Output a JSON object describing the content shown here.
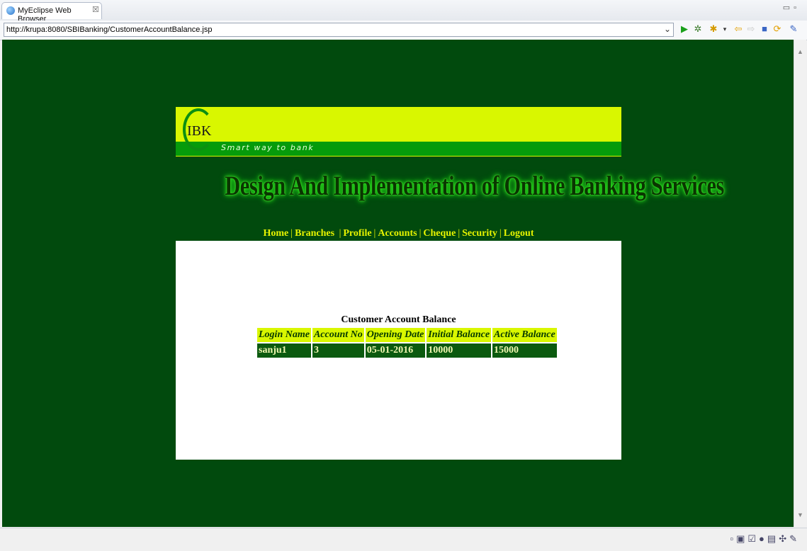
{
  "browser": {
    "tab_title": "MyEclipse Web Browser",
    "url": "http://krupa:8080/SBIBanking/CustomerAccountBalance.jsp"
  },
  "banner": {
    "logo_text": "IBK",
    "tagline": "Smart way to bank"
  },
  "site_title": "Design And Implementation of  Online Banking Services",
  "nav": {
    "items": [
      "Home",
      "Branches",
      "Profile",
      "Accounts",
      "Cheque",
      "Security",
      "Logout"
    ]
  },
  "balance": {
    "caption": "Customer Account Balance",
    "headers": [
      "Login Name",
      "Account No",
      "Opening Date",
      "Initial Balance",
      "Active Balance"
    ],
    "rows": [
      [
        "sanju1",
        "3",
        "05-01-2016",
        "10000",
        "15000"
      ]
    ]
  },
  "colors": {
    "page_bg": "#014a0d",
    "accent_yellow": "#d9f700",
    "banner_green": "#069b0b",
    "cell_green": "#0b5a0f"
  }
}
